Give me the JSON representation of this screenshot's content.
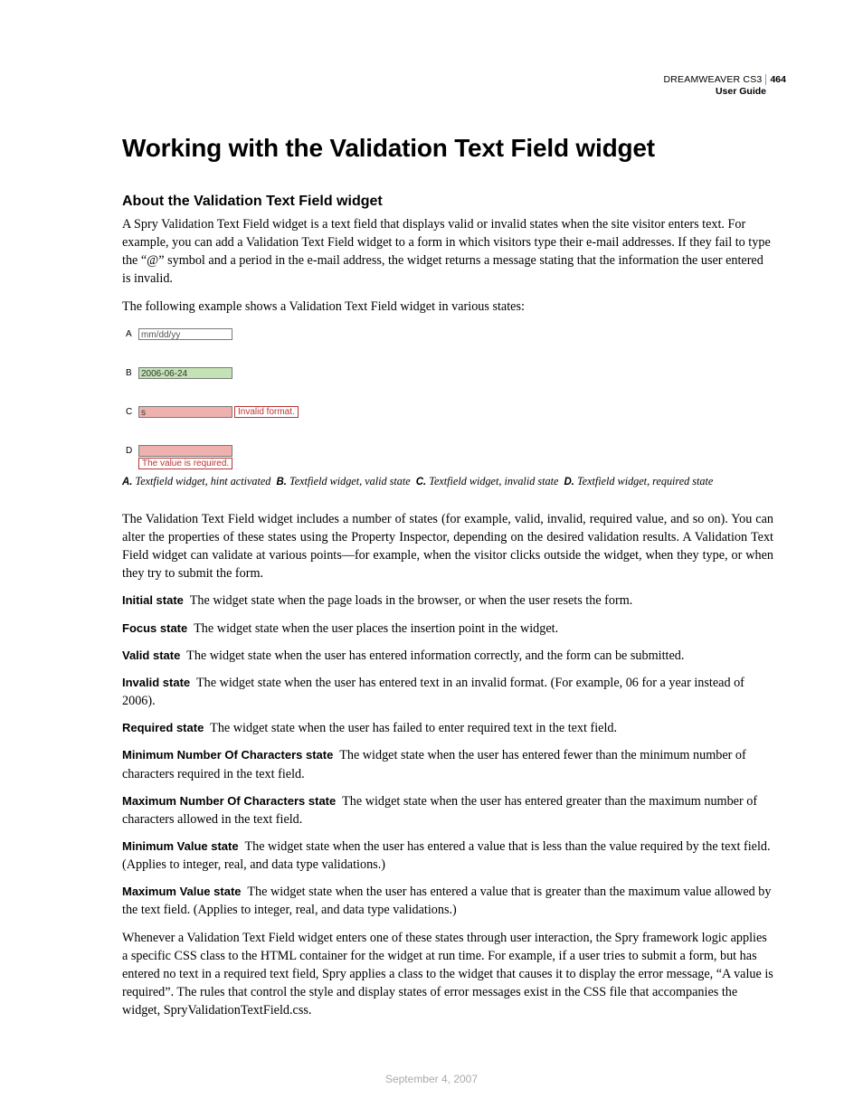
{
  "header": {
    "product": "DREAMWEAVER CS3",
    "page_number": "464",
    "guide": "User Guide"
  },
  "title": "Working with the Validation Text Field widget",
  "subhead": "About the Validation Text Field widget",
  "intro_p1": "A Spry Validation Text Field widget is a text field that displays valid or invalid states when the site visitor enters text. For example, you can add a Validation Text Field widget to a form in which visitors type their e-mail addresses. If they fail to type the “@” symbol and a period in the e-mail address, the widget returns a message stating that the information the user entered is invalid.",
  "intro_p2": "The following example shows a Validation Text Field widget in various states:",
  "states_fig": {
    "A": {
      "letter": "A",
      "value": "mm/dd/yy"
    },
    "B": {
      "letter": "B",
      "value": "2006-06-24"
    },
    "C": {
      "letter": "C",
      "value": "s",
      "msg": "Invalid format."
    },
    "D": {
      "letter": "D",
      "value": "",
      "msg": "The value is required."
    }
  },
  "caption": {
    "A": {
      "label": "A.",
      "text": "Textfield widget, hint activated"
    },
    "B": {
      "label": "B.",
      "text": "Textfield widget, valid state"
    },
    "C": {
      "label": "C.",
      "text": "Textfield widget, invalid state"
    },
    "D": {
      "label": "D.",
      "text": "Textfield widget, required state"
    }
  },
  "overview": "The Validation Text Field widget includes a number of states (for example, valid, invalid, required value, and so on). You can alter the properties of these states using the Property Inspector, depending on the desired validation results. A Validation Text Field widget can validate at various points—for example, when the visitor clicks outside the widget, when they type, or when they try to submit the form.",
  "defs": {
    "initial": {
      "term": "Initial state",
      "desc": "The widget state when the page loads in the browser, or when the user resets the form."
    },
    "focus": {
      "term": "Focus state",
      "desc": "The widget state when the user places the insertion point in the widget."
    },
    "valid": {
      "term": "Valid state",
      "desc": "The widget state when the user has entered information correctly, and the form can be submitted."
    },
    "invalid": {
      "term": "Invalid state",
      "desc": "The widget state when the user has entered text in an invalid format. (For example, 06 for a year instead of 2006)."
    },
    "required": {
      "term": "Required state",
      "desc": "The widget state when the user has failed to enter required text in the text field."
    },
    "minchars": {
      "term": "Minimum Number Of Characters state",
      "desc": "The widget state when the user has entered fewer than the minimum number of characters required in the text field."
    },
    "maxchars": {
      "term": "Maximum Number Of Characters state",
      "desc": "The widget state when the user has entered greater than the maximum number of characters allowed in the text field."
    },
    "minval": {
      "term": "Minimum Value state",
      "desc": "The widget state when the user has entered a value that is less than the value required by the text field. (Applies to integer, real, and data type validations.)"
    },
    "maxval": {
      "term": "Maximum Value state",
      "desc": "The widget state when the user has entered a value that is greater than the maximum value allowed by the text field. (Applies to integer, real, and data type validations.)"
    }
  },
  "closing": "Whenever a Validation Text Field widget enters one of these states through user interaction, the Spry framework logic applies a specific CSS class to the HTML container for the widget at run time. For example, if a user tries to submit a form, but has entered no text in a required text field, Spry applies a class to the widget that causes it to display the error message, “A value is required”. The rules that control the style and display states of error messages exist in the CSS file that accompanies the widget, SpryValidationTextField.css.",
  "footer_date": "September 4, 2007"
}
